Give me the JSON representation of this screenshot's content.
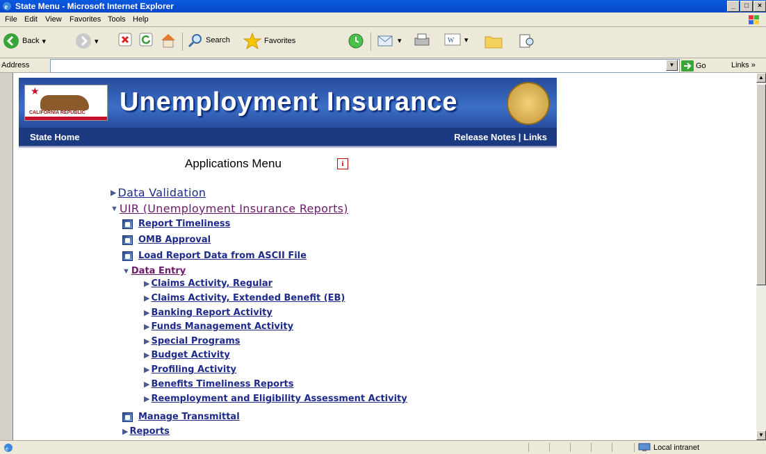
{
  "window": {
    "title": "State Menu - Microsoft Internet Explorer"
  },
  "menubar": {
    "items": [
      "File",
      "Edit",
      "View",
      "Favorites",
      "Tools",
      "Help"
    ]
  },
  "toolbar": {
    "back_label": "Back",
    "search_label": "Search",
    "favorites_label": "Favorites"
  },
  "addressbar": {
    "label": "Address",
    "value": "",
    "go_label": "Go",
    "links_label": "Links"
  },
  "status": {
    "zone": "Local intranet"
  },
  "banner": {
    "title": "Unemployment Insurance",
    "flag_text": "CALIFORNIA REPUBLIC"
  },
  "nav": {
    "home": "State Home",
    "right": "Release Notes | Links"
  },
  "page": {
    "heading": "Applications Menu",
    "info_glyph": "i"
  },
  "menu": {
    "data_validation": "Data Validation",
    "uir": "UIR (Unemployment Insurance Reports)",
    "report_timeliness": "Report Timeliness",
    "omb_approval": "OMB Approval",
    "load_report": "Load Report Data from ASCII File",
    "data_entry": "Data Entry",
    "data_entry_items": [
      "Claims Activity, Regular",
      "Claims Activity, Extended Benefit (EB)",
      "Banking Report Activity",
      "Funds Management Activity",
      "Special Programs",
      "Budget Activity",
      "Profiling Activity",
      "Benefits Timeliness Reports",
      "Reemployment and Eligibility Assessment Activity"
    ],
    "manage_transmittal": "Manage Transmittal",
    "reports": "Reports"
  },
  "colors": {
    "link": "#1f2b8a",
    "visited": "#6b1a6b",
    "banner": "#274b9d",
    "navbar": "#1c3a82"
  }
}
